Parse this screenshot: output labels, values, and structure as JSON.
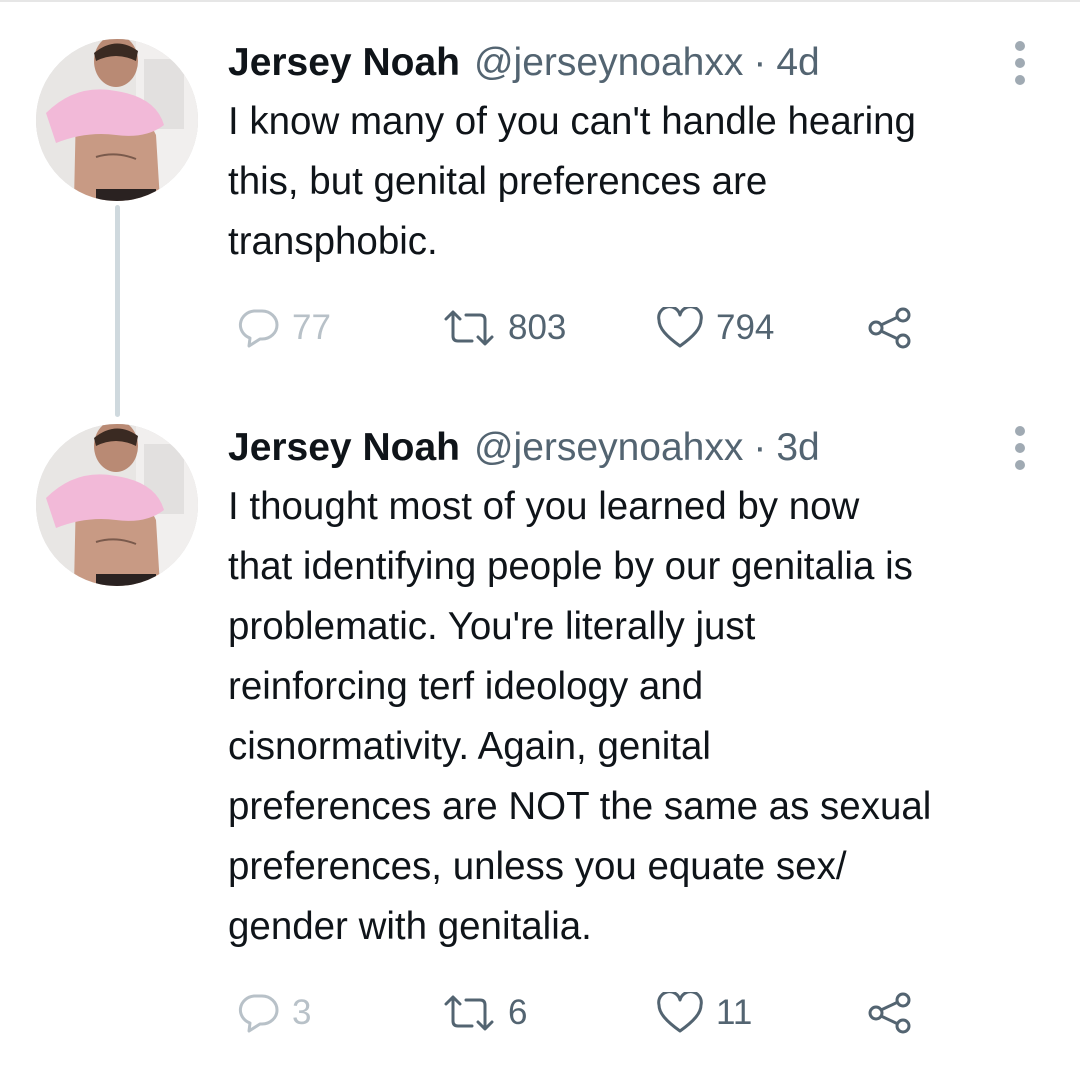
{
  "tweets": [
    {
      "author_name": "Jersey Noah",
      "handle": "@jerseynoahxx",
      "separator": "·",
      "time": "4d",
      "text_lines": [
        "I know many of you can't handle hearing",
        "this, but genital preferences are",
        "transphobic."
      ],
      "replies": "77",
      "retweets": "803",
      "likes": "794"
    },
    {
      "author_name": "Jersey Noah",
      "handle": "@jerseynoahxx",
      "separator": "·",
      "time": "3d",
      "text_lines": [
        "I thought most of you learned by now",
        "that identifying people by our genitalia is",
        "problematic. You're literally just",
        "reinforcing terf ideology and",
        "cisnormativity. Again, genital",
        "preferences are NOT the same as sexual",
        "preferences, unless you equate sex/",
        "gender with genitalia."
      ],
      "replies": "3",
      "retweets": "6",
      "likes": "11"
    }
  ],
  "icons": {
    "reply": "reply-icon",
    "retweet": "retweet-icon",
    "like": "like-icon",
    "share": "share-icon",
    "more": "more-options-icon"
  },
  "colors": {
    "text": "#0f1419",
    "secondary": "#536471",
    "thread_line": "#cfd9de",
    "background": "#ffffff"
  }
}
